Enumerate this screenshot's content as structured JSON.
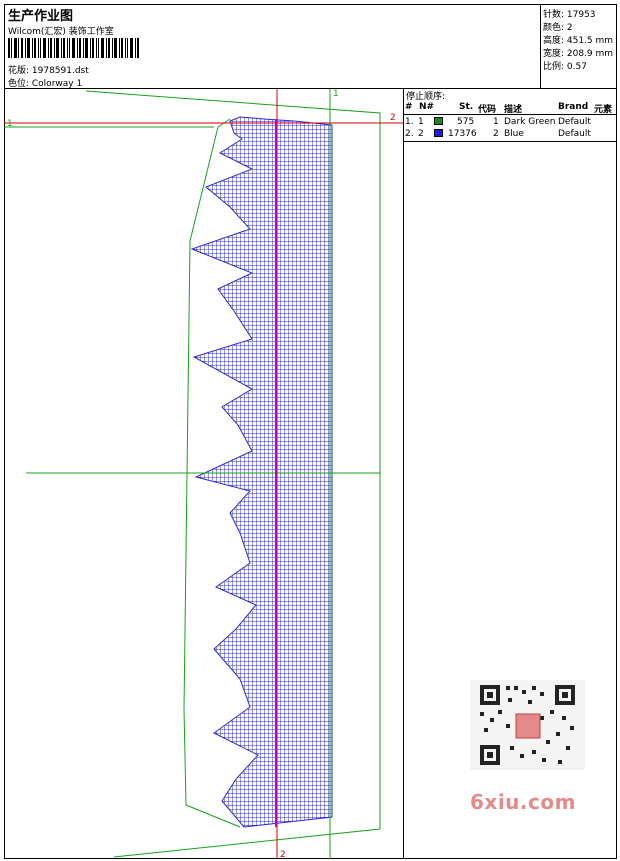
{
  "header": {
    "title": "生产作业图",
    "company": "Wilcom(汇宏) 装饰工作室",
    "design_label": "花版: 1978591.dst",
    "colorway_label": "色位: Colorway 1"
  },
  "stats": [
    "针数: 17953",
    "颜色: 2",
    "高度: 451.5 mm",
    "宽度: 208.9 mm",
    "比例: 0.57"
  ],
  "stop_sequence": {
    "title": "停止顺序:",
    "columns": [
      "#",
      "N#",
      "St.",
      "代码",
      "描述",
      "Brand",
      "元素"
    ],
    "rows": [
      {
        "idx": "1.",
        "n": "1",
        "stitches": "575",
        "code": "1",
        "desc": "Dark Green",
        "brand": "Default",
        "color": "#1a8a1a"
      },
      {
        "idx": "2.",
        "n": "2",
        "stitches": "17376",
        "code": "2",
        "desc": "Blue",
        "brand": "Default",
        "color": "#1a1ae6"
      }
    ]
  },
  "guides": {
    "h_top_left": "1",
    "h_top_right": "2",
    "v_green_top": "1",
    "v_red_bottom": "2"
  },
  "watermark": {
    "site": "6xiu.com"
  },
  "colors": {
    "stitch_blue": "#2a2ad8",
    "outline_green": "#1aa01a",
    "guide_red": "#d00000",
    "guide_magenta": "#c000c0"
  }
}
